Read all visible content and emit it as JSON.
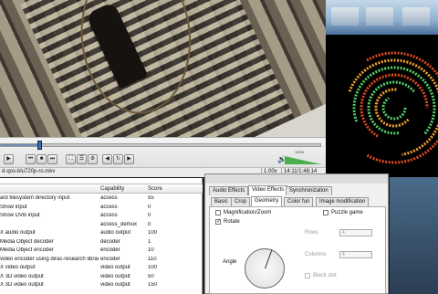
{
  "player": {
    "filename": "d-qos-blu720p-ro.mkv",
    "speed": "1.00x",
    "time": "14:11/1:46:14",
    "volume_pct": "100%",
    "seek_progress": 0.12
  },
  "table": {
    "headers": {
      "name": "",
      "capability": "Capability",
      "score": "Score"
    },
    "rows": [
      {
        "name": "ard filesystem directory input",
        "capability": "access",
        "score": "55"
      },
      {
        "name": "Show input",
        "capability": "access",
        "score": "0"
      },
      {
        "name": "Show DVB input",
        "capability": "access",
        "score": "0"
      },
      {
        "name": "",
        "capability": "access_demux",
        "score": "0"
      },
      {
        "name": "X audio output",
        "capability": "audio output",
        "score": "100"
      },
      {
        "name": "Media Object decoder",
        "capability": "decoder",
        "score": "1"
      },
      {
        "name": "Media Object encoder",
        "capability": "encoder",
        "score": "10"
      },
      {
        "name": "video encoder using dirac-research library",
        "capability": "encoder",
        "score": "110"
      },
      {
        "name": "X video output",
        "capability": "video output",
        "score": "100"
      },
      {
        "name": "X 3D video output",
        "capability": "video output",
        "score": "50"
      },
      {
        "name": "X 3D video output",
        "capability": "video output",
        "score": "150"
      }
    ]
  },
  "effects": {
    "top_tabs": [
      "Audio Effects",
      "Video Effects",
      "Synchronization"
    ],
    "sub_tabs": [
      "Basic",
      "Crop",
      "Geometry",
      "Color fun",
      "Image modification"
    ],
    "magnification_label": "Magnification/Zoom",
    "rotate_label": "Rotate",
    "angle_label": "Angle",
    "puzzle_label": "Puzzle game",
    "rows_label": "Rows",
    "rows_value": "4",
    "columns_label": "Columns",
    "columns_value": "4",
    "black_slot_label": "Black slot"
  },
  "colors": {
    "viz_green": "#55d06a",
    "viz_orange": "#f0a030",
    "viz_red": "#e04a20",
    "volume_green": "#4bb04b"
  }
}
